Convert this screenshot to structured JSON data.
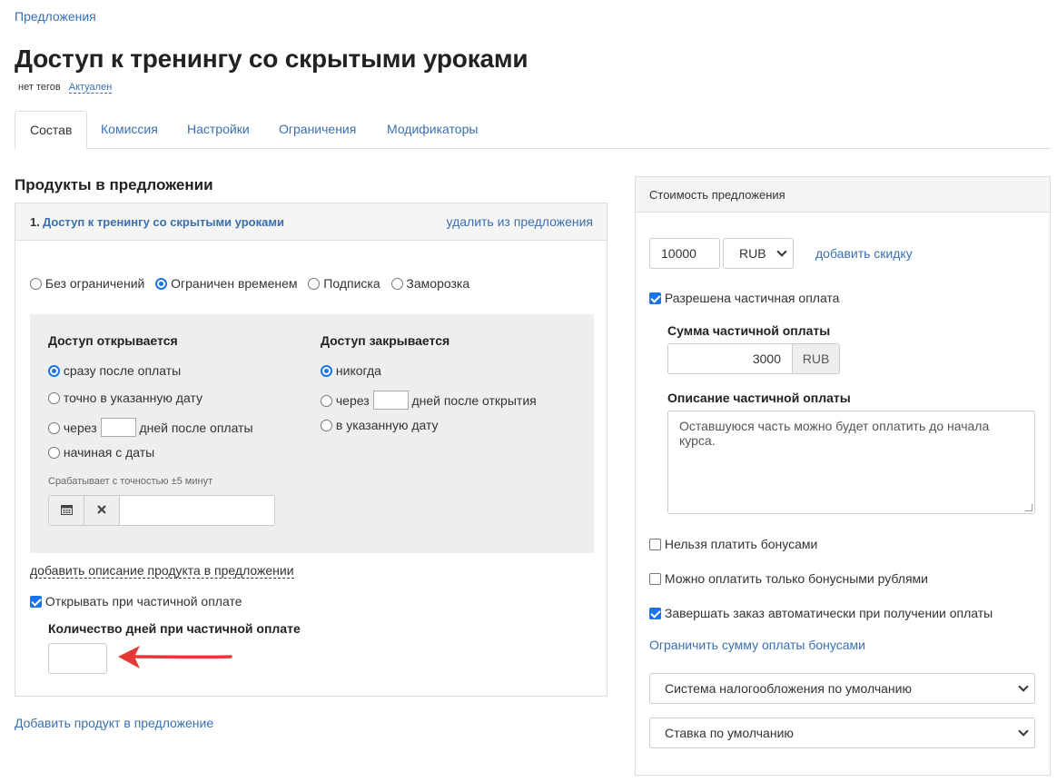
{
  "breadcrumb": "Предложения",
  "title": "Доступ к тренингу со скрытыми уроками",
  "meta": {
    "tags": "нет тегов",
    "status": "Актуален"
  },
  "tabs": [
    "Состав",
    "Комиссия",
    "Настройки",
    "Ограничения",
    "Модификаторы"
  ],
  "active_tab": "Состав",
  "products": {
    "section_title": "Продукты в предложении",
    "item_number": "1.",
    "item_name": "Доступ к тренингу со скрытыми уроками",
    "remove_link": "удалить из предложения",
    "access_types": [
      {
        "label": "Без ограничений",
        "checked": false
      },
      {
        "label": "Ограничен временем",
        "checked": true
      },
      {
        "label": "Подписка",
        "checked": false
      },
      {
        "label": "Заморозка",
        "checked": false
      }
    ],
    "opens": {
      "heading": "Доступ открывается",
      "opt1": "сразу после оплаты",
      "opt2": "точно в указанную дату",
      "opt3_pre": "через",
      "opt3_post": "дней после оплаты",
      "opt4": "начиная с даты",
      "hint": "Срабатывает с точностью ±5 минут"
    },
    "closes": {
      "heading": "Доступ закрывается",
      "opt1": "никогда",
      "opt2_pre": "через",
      "opt2_post": "дней после открытия",
      "opt3": "в указанную дату"
    },
    "add_description": "добавить описание продукта в предложении",
    "open_on_partial": "Открывать при частичной оплате",
    "days_label": "Количество дней при частичной оплате",
    "days_value": ""
  },
  "add_product": "Добавить продукт в предложение",
  "price": {
    "heading": "Стоимость предложения",
    "amount": "10000",
    "currency": "RUB",
    "add_discount": "добавить скидку",
    "partial_allowed": "Разрешена частичная оплата",
    "partial_sum_label": "Сумма частичной оплаты",
    "partial_sum": "3000",
    "partial_currency": "RUB",
    "partial_desc_label": "Описание частичной оплаты",
    "partial_desc": "Оставшуюся часть можно будет оплатить до начала курса.",
    "no_bonuses": "Нельзя платить бонусами",
    "only_bonuses": "Можно оплатить только бонусными рублями",
    "auto_complete": "Завершать заказ автоматически при получении оплаты",
    "limit_bonus": "Ограничить сумму оплаты бонусами",
    "tax_system": "Система налогообложения по умолчанию",
    "rate": "Ставка по умолчанию"
  },
  "colors": {
    "link": "#3a6fb0",
    "checkbox": "#1a73e8",
    "arrow": "#e53935"
  }
}
